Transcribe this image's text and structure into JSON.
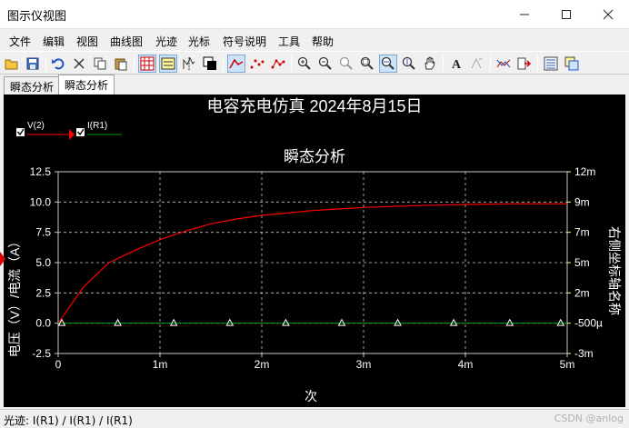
{
  "window": {
    "title": "图示仪视图"
  },
  "menu": [
    "文件",
    "编辑",
    "视图",
    "曲线图",
    "光迹",
    "光标",
    "符号说明",
    "工具",
    "帮助"
  ],
  "tabs": [
    {
      "label": "瞬态分析",
      "active": false
    },
    {
      "label": "瞬态分析",
      "active": true
    }
  ],
  "toolbar_icons": [
    "open-icon",
    "save-icon",
    "undo-icon",
    "cut-icon",
    "copy-icon",
    "paste-icon",
    "grid-icon",
    "legend-icon",
    "cursor-icon",
    "reverse-colors-icon",
    "line-icon",
    "points-icon",
    "line-points-icon",
    "zoom-in-icon",
    "zoom-out-icon",
    "zoom-fit-icon",
    "zoom-area-icon",
    "zoom-x-icon",
    "zoom-y-icon",
    "pan-hand-icon",
    "text-icon",
    "label-icon",
    "merge-traces-icon",
    "export-icon",
    "properties-icon",
    "overlay-icon"
  ],
  "plot": {
    "main_title": "电容充电仿真 2024年8月15日",
    "chart_title": "瞬态分析",
    "legend": [
      {
        "label": "V(2)",
        "color": "#ff0000"
      },
      {
        "label": "I(R1)",
        "color": "#00a000"
      }
    ],
    "colors": {
      "background": "#000000",
      "grid": "#c8c8c8",
      "axis_text": "#ffffff",
      "trace_v": "#ff0000",
      "trace_i": "#00a000",
      "right_axis": "#ffff99"
    }
  },
  "chart_data": {
    "type": "line",
    "title": "瞬态分析",
    "xlabel": "次",
    "ylabel": "电压（V）/电流（A）",
    "y2label": "右侧坐标轴名称",
    "xlim": [
      0,
      0.005
    ],
    "ylim": [
      -2.5,
      12.5
    ],
    "y2lim": [
      -0.003,
      0.012
    ],
    "x_ticks": [
      0,
      0.001,
      0.002,
      0.003,
      0.004,
      0.005
    ],
    "x_tick_labels": [
      "0",
      "1m",
      "2m",
      "3m",
      "4m",
      "5m"
    ],
    "y_ticks": [
      12.5,
      10.0,
      7.5,
      5.0,
      2.5,
      0.0,
      -2.5
    ],
    "y_tick_labels": [
      "12.5",
      "10.0",
      "7.5",
      "5.0",
      "2.5",
      "0.0",
      "-2.5"
    ],
    "y2_tick_labels": [
      "12m",
      "9m",
      "7m",
      "5m",
      "2m",
      "-500µ",
      "-3m"
    ],
    "grid": true,
    "series": [
      {
        "name": "V(2)",
        "axis": "left",
        "x": [
          0,
          0.00025,
          0.0005,
          0.00075,
          0.001,
          0.00125,
          0.0015,
          0.00175,
          0.002,
          0.0025,
          0.003,
          0.0035,
          0.004,
          0.0045,
          0.005
        ],
        "values": [
          0.0,
          3.0,
          5.0,
          6.0,
          6.9,
          7.6,
          8.2,
          8.6,
          8.9,
          9.3,
          9.55,
          9.7,
          9.8,
          9.85,
          9.85
        ]
      },
      {
        "name": "I(R1)",
        "axis": "right",
        "x": [
          0,
          0.00055,
          0.0011,
          0.00165,
          0.0022,
          0.00275,
          0.0033,
          0.00385,
          0.0044,
          0.0049
        ],
        "values": [
          -0.0005,
          -0.0005,
          -0.0005,
          -0.0005,
          -0.0005,
          -0.0005,
          -0.0005,
          -0.0005,
          -0.0005,
          -0.0005
        ],
        "marker": "triangle"
      }
    ]
  },
  "status": {
    "text": "光迹: I(R1) / I(R1) / I(R1)",
    "watermark": "CSDN @anlog"
  }
}
